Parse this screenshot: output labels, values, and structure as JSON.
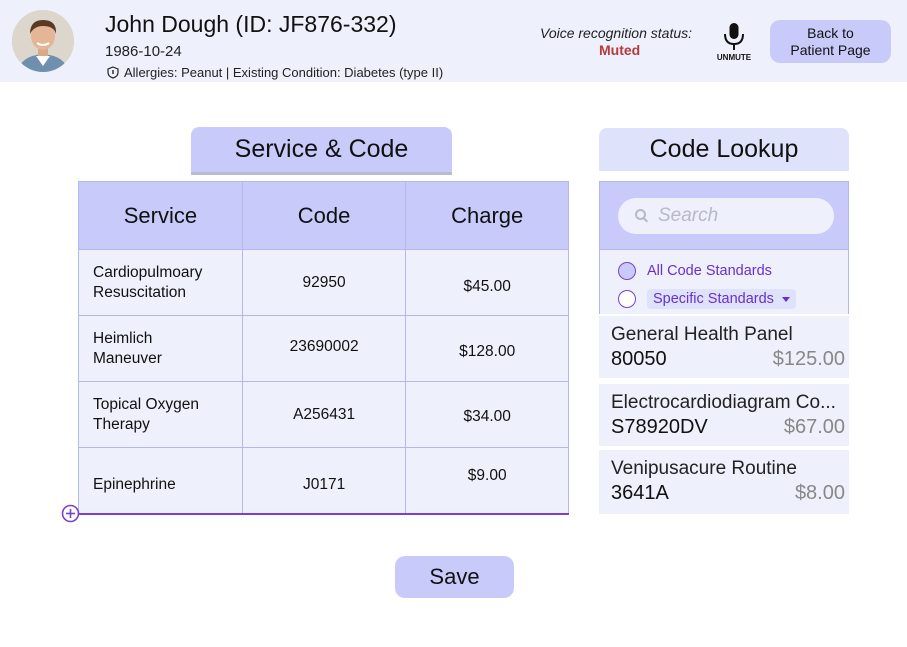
{
  "patient": {
    "name_line": "John Dough (ID: JF876-332)",
    "dob": "1986-10-24",
    "allergies_line": "Allergies: Peanut | Existing Condition: Diabetes (type II)"
  },
  "voice": {
    "label": "Voice recognition status:",
    "status": "Muted",
    "mic_label": "UNMUTE"
  },
  "header": {
    "back_label_line1": "Back to",
    "back_label_line2": "Patient Page"
  },
  "service_code": {
    "title": "Service & Code",
    "columns": [
      "Service",
      "Code",
      "Charge"
    ],
    "rows": [
      {
        "service_l1": "Cardiopulmoary",
        "service_l2": "Resuscitation",
        "code": "92950",
        "charge": "$45.00"
      },
      {
        "service_l1": "Heimlich",
        "service_l2": "Maneuver",
        "code": "23690002",
        "charge": "$128.00"
      },
      {
        "service_l1": "Topical Oxygen",
        "service_l2": "Therapy",
        "code": "A256431",
        "charge": "$34.00"
      },
      {
        "service_l1": "Epinephrine",
        "service_l2": "",
        "code": "J0171",
        "charge": "$9.00"
      }
    ]
  },
  "code_lookup": {
    "title": "Code Lookup",
    "search_placeholder": "Search",
    "filter_all": "All Code Standards",
    "filter_specific": "Specific Standards",
    "results": [
      {
        "name": "General Health Panel",
        "code": "80050",
        "price": "$125.00"
      },
      {
        "name": "Electrocardiodiagram Co...",
        "code": "S78920DV",
        "price": "$67.00"
      },
      {
        "name": "Venipusacure Routine",
        "code": "3641A",
        "price": "$8.00"
      }
    ]
  },
  "actions": {
    "save_label": "Save"
  },
  "colors": {
    "accent": "#c8cbfa",
    "panel": "#eef0fc",
    "purple": "#7b3fd6",
    "muted_red": "#b53a3a"
  }
}
